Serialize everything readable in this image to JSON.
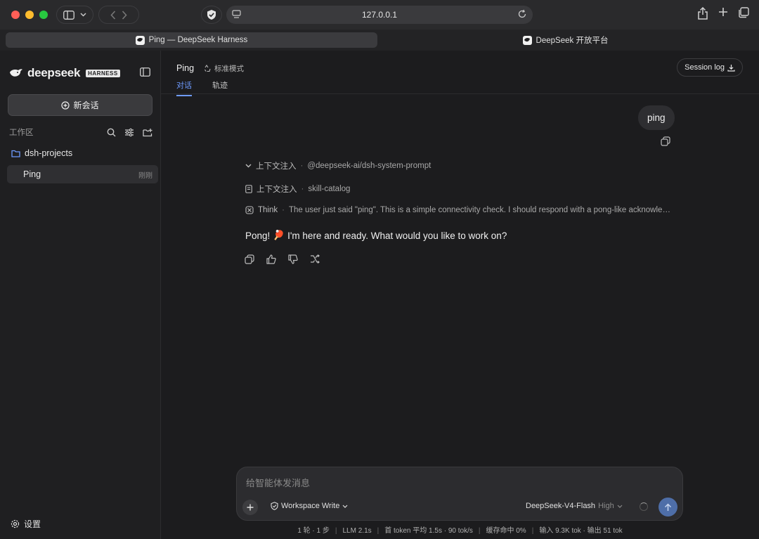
{
  "browser": {
    "url": "127.0.0.1",
    "tabs": [
      {
        "label": "Ping — DeepSeek Harness",
        "active": true
      },
      {
        "label": "DeepSeek 开放平台",
        "active": false
      }
    ]
  },
  "sidebar": {
    "brand": "deepseek",
    "badge": "HARNESS",
    "new_chat": "新会话",
    "workspace_label": "工作区",
    "folder": "dsh-projects",
    "chats": [
      {
        "name": "Ping",
        "time": "刚刚"
      }
    ],
    "settings": "设置"
  },
  "header": {
    "title": "Ping",
    "mode": "标准模式",
    "tabs": [
      {
        "label": "对话",
        "active": true
      },
      {
        "label": "轨迹",
        "active": false
      }
    ],
    "session_log": "Session log"
  },
  "conversation": {
    "user_message": "ping",
    "steps": [
      {
        "label": "上下文注入",
        "detail": "@deepseek-ai/dsh-system-prompt",
        "icon": "chevron-down-icon"
      },
      {
        "label": "上下文注入",
        "detail": "skill-catalog",
        "icon": "document-icon"
      },
      {
        "label": "Think",
        "detail": "The user just said \"ping\". This is a simple connectivity check. I should respond with a pong-like acknowledgment.",
        "icon": "brain-icon"
      }
    ],
    "reply_before": "Pong!",
    "reply_emoji": "🏓",
    "reply_after": "I'm here and ready. What would you like to work on?"
  },
  "composer": {
    "placeholder": "给智能体发消息",
    "permission": "Workspace Write",
    "model": "DeepSeek-V4-Flash",
    "effort": "High"
  },
  "status": {
    "items": [
      "1 轮 · 1 步",
      "LLM 2.1s",
      "首 token 平均 1.5s · 90 tok/s",
      "缓存命中 0%",
      "输入 9.3K tok · 输出 51 tok"
    ]
  },
  "colors": {
    "accent": "#6e9bff",
    "send": "#4e6ea8",
    "background": "#1c1c1e"
  }
}
